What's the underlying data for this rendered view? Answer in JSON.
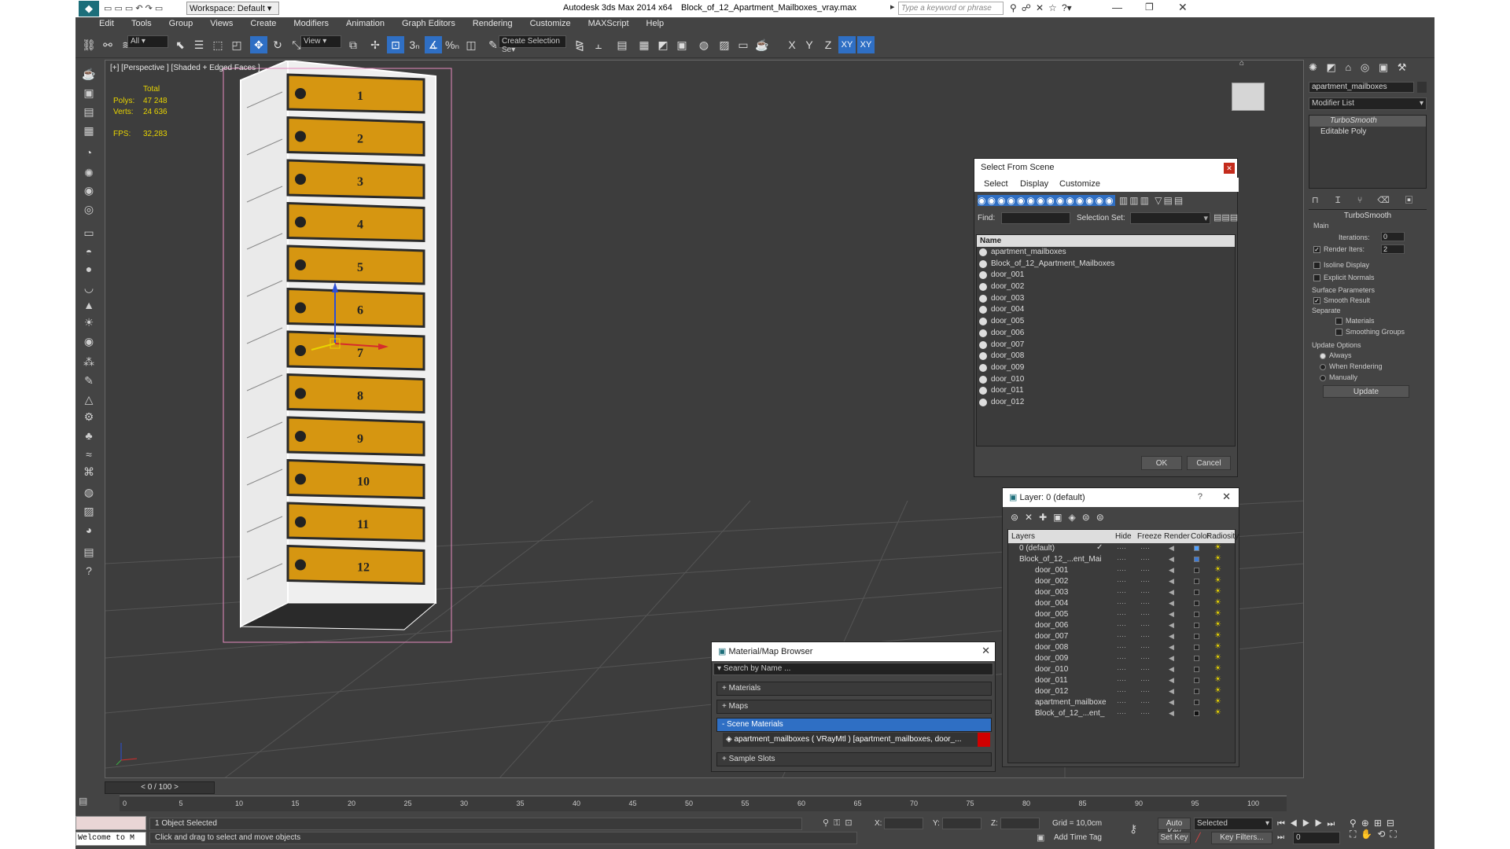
{
  "titlebar": {
    "workspace": "Workspace: Default",
    "app": "Autodesk 3ds Max  2014 x64",
    "file": "Block_of_12_Apartment_Mailboxes_vray.max",
    "search_placeholder": "Type a keyword or phrase"
  },
  "menu": [
    "Edit",
    "Tools",
    "Group",
    "Views",
    "Create",
    "Modifiers",
    "Animation",
    "Graph Editors",
    "Rendering",
    "Customize",
    "MAXScript",
    "Help"
  ],
  "toolbar": {
    "filter": "All",
    "refcoord": "View",
    "selection_set": "Create Selection Se",
    "axes": [
      "X",
      "Y",
      "Z",
      "XY",
      "XY"
    ],
    "snap": "3",
    "angle": "%"
  },
  "viewport": {
    "label": "[+] [Perspective ] [Shaded + Edged Faces ]",
    "stats": {
      "total": "Total",
      "polys_label": "Polys:",
      "polys": "47 248",
      "verts_label": "Verts:",
      "verts": "24 636",
      "fps_label": "FPS:",
      "fps": "32,283"
    },
    "door_numbers": [
      "1",
      "2",
      "3",
      "4",
      "5",
      "6",
      "7",
      "8",
      "9",
      "10",
      "11",
      "12"
    ]
  },
  "select_dialog": {
    "title": "Select From Scene",
    "tabs": [
      "Select",
      "Display",
      "Customize"
    ],
    "find_label": "Find:",
    "selset_label": "Selection Set:",
    "col": "Name",
    "items": [
      "apartment_mailboxes",
      "Block_of_12_Apartment_Mailboxes",
      "door_001",
      "door_002",
      "door_003",
      "door_004",
      "door_005",
      "door_006",
      "door_007",
      "door_008",
      "door_009",
      "door_010",
      "door_011",
      "door_012"
    ],
    "ok": "OK",
    "cancel": "Cancel"
  },
  "layer_dialog": {
    "title": "Layer: 0 (default)",
    "help": "?",
    "cols": [
      "Layers",
      "Hide",
      "Freeze",
      "Render",
      "Color",
      "Radiosity"
    ],
    "rows": [
      "0 (default)",
      "Block_of_12_...ent_Mai",
      "door_001",
      "door_002",
      "door_003",
      "door_004",
      "door_005",
      "door_006",
      "door_007",
      "door_008",
      "door_009",
      "door_010",
      "door_011",
      "door_012",
      "apartment_mailboxe",
      "Block_of_12_...ent_"
    ],
    "row_colors": [
      "#4fa0ff",
      "#3d7bd6",
      "#222",
      "#222",
      "#222",
      "#222",
      "#222",
      "#222",
      "#222",
      "#222",
      "#222",
      "#222",
      "#222",
      "#222",
      "#222",
      "#111"
    ]
  },
  "material_browser": {
    "title": "Material/Map Browser",
    "search_placeholder": "Search by Name ...",
    "sections": [
      "+ Materials",
      "+ Maps",
      "- Scene Materials",
      "+ Sample Slots"
    ],
    "scene_material": "apartment_mailboxes  ( VRayMtl ) [apartment_mailboxes, door_..."
  },
  "command_panel": {
    "object_name": "apartment_mailboxes",
    "modifier_list": "Modifier List",
    "stack": [
      "TurboSmooth",
      "Editable Poly"
    ],
    "rollout": "TurboSmooth",
    "main": "Main",
    "iterations_label": "Iterations:",
    "iterations": "0",
    "render_iters_label": "Render Iters:",
    "render_iters": "2",
    "isoline": "Isoline Display",
    "explicit": "Explicit Normals",
    "surface_params": "Surface Parameters",
    "smooth_result": "Smooth Result",
    "separate": "Separate",
    "materials": "Materials",
    "smoothing_groups": "Smoothing Groups",
    "update_options": "Update Options",
    "always": "Always",
    "when_rendering": "When Rendering",
    "manually": "Manually",
    "update": "Update"
  },
  "timeline": {
    "frame": "0 / 100",
    "ticks": [
      "0",
      "5",
      "10",
      "15",
      "20",
      "25",
      "30",
      "35",
      "40",
      "45",
      "50",
      "55",
      "60",
      "65",
      "70",
      "75",
      "80",
      "85",
      "90",
      "95",
      "100"
    ]
  },
  "status": {
    "welcome": "Welcome to M",
    "selected": "1 Object Selected",
    "prompt": "Click and drag to select and move objects",
    "x_label": "X:",
    "y_label": "Y:",
    "z_label": "Z:",
    "grid": "Grid = 10,0cm",
    "add_time_tag": "Add Time Tag",
    "auto_key": "Auto Key",
    "set_key": "Set Key",
    "selected_dd": "Selected",
    "key_filters": "Key Filters...",
    "frame_field": "0"
  },
  "colors": {
    "door": "#d69611",
    "accent": "#2f6fc4"
  }
}
